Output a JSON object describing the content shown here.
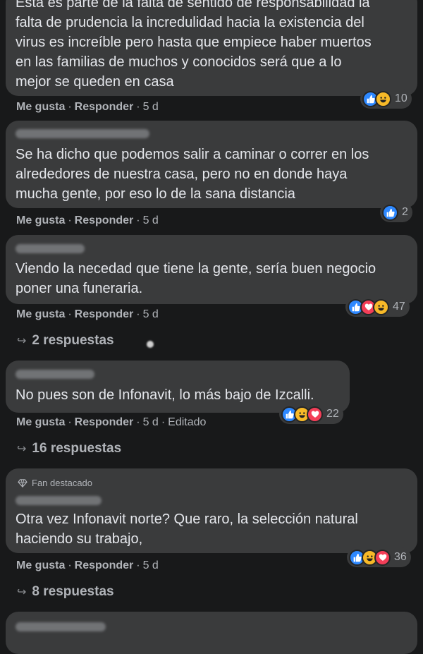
{
  "comments": [
    {
      "lines": [
        "Esta es parte de la falta de sentido de responsabilidad la",
        "falta de prudencia la incredulidad hacia la existencia del",
        "virus es increíble pero hasta que empiece haber muertos",
        "en las familias de muchos y conocidos será que a lo",
        "mejor se queden en casa"
      ],
      "like": "Me gusta",
      "reply": "Responder",
      "time": "5 d",
      "reactions": [
        "like",
        "haha"
      ],
      "count": "10"
    },
    {
      "lines": [
        "Se ha dicho que podemos salir a caminar o correr en los",
        "alrededores de nuestra casa, pero no en donde haya",
        "mucha gente, por eso lo de la sana distancia"
      ],
      "like": "Me gusta",
      "reply": "Responder",
      "time": "5 d",
      "reactions": [
        "like"
      ],
      "count": "2"
    },
    {
      "lines": [
        "Viendo la necedad que tiene la gente, sería buen negocio",
        "poner una funeraria."
      ],
      "like": "Me gusta",
      "reply": "Responder",
      "time": "5 d",
      "reactions": [
        "like",
        "love",
        "haha"
      ],
      "count": "47",
      "replies": "2 respuestas"
    },
    {
      "lines": [
        "No pues son de Infonavit, lo más bajo de Izcalli."
      ],
      "like": "Me gusta",
      "reply": "Responder",
      "time": "5 d",
      "edited": "Editado",
      "reactions": [
        "like",
        "haha",
        "love"
      ],
      "count": "22",
      "replies": "16 respuestas"
    },
    {
      "badge": "Fan destacado",
      "lines": [
        "Otra vez Infonavit norte? Que raro, la selección natural",
        "haciendo su trabajo,"
      ],
      "like": "Me gusta",
      "reply": "Responder",
      "time": "5 d",
      "reactions": [
        "like",
        "haha",
        "love"
      ],
      "count": "36",
      "replies": "8 respuestas"
    }
  ],
  "colors": {
    "background": "#18191a",
    "bubble": "#3a3b3c",
    "text": "#e4e6eb",
    "muted": "#b0b3b8",
    "like": "#2d88ff",
    "love": "#f33e58",
    "haha": "#f7b928"
  }
}
